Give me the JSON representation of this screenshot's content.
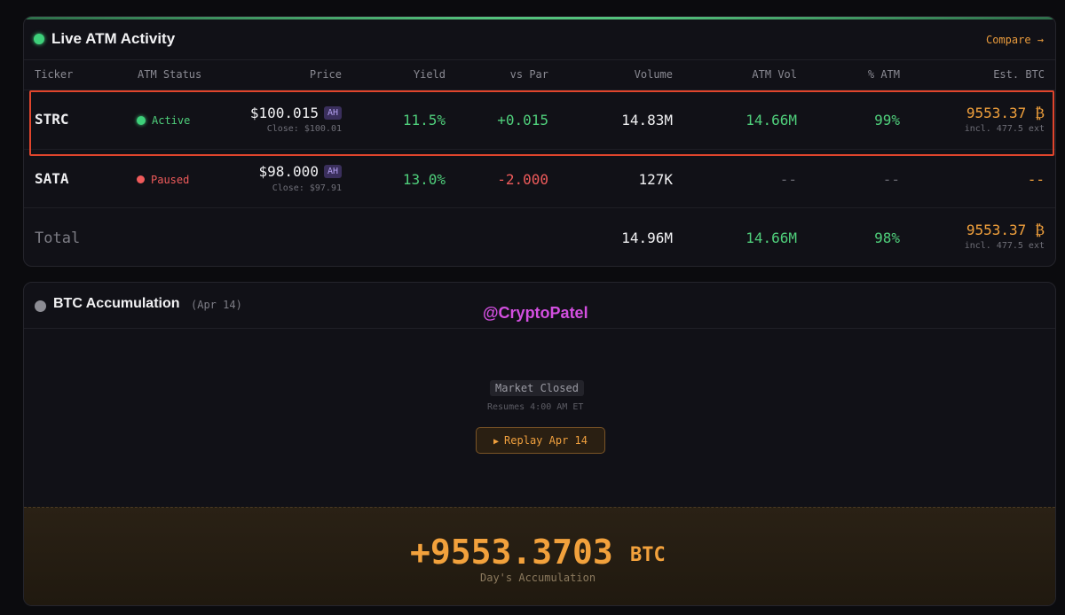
{
  "atm": {
    "title": "Live ATM Activity",
    "compare_label": "Compare →",
    "columns": [
      "Ticker",
      "ATM Status",
      "Price",
      "Yield",
      "vs Par",
      "Volume",
      "ATM Vol",
      "% ATM",
      "Est. BTC"
    ],
    "rows": [
      {
        "ticker": "STRC",
        "status": "Active",
        "price": "$100.015",
        "badge": "AH",
        "close": "Close: $100.01",
        "yield": "11.5%",
        "vs_par": "+0.015",
        "volume": "14.83M",
        "atm_vol": "14.66M",
        "pct_atm": "99%",
        "est_btc": "9553.37 ₿",
        "est_btc_sub": "incl. 477.5 ext"
      },
      {
        "ticker": "SATA",
        "status": "Paused",
        "price": "$98.000",
        "badge": "AH",
        "close": "Close: $97.91",
        "yield": "13.0%",
        "vs_par": "-2.000",
        "volume": "127K",
        "atm_vol": "--",
        "pct_atm": "--",
        "est_btc": "--"
      }
    ],
    "total": {
      "label": "Total",
      "volume": "14.96M",
      "atm_vol": "14.66M",
      "pct_atm": "98%",
      "est_btc": "9553.37 ₿",
      "est_btc_sub": "incl. 477.5 ext"
    },
    "colors": {
      "active": "#3ed07a",
      "paused": "#ef5b5b",
      "highlight": "#e0452c"
    }
  },
  "accumulation": {
    "title": "BTC Accumulation",
    "date": "(Apr 14)",
    "watermark": "@CryptoPatel",
    "market_status": "Market Closed",
    "resumes": "Resumes 4:00 AM ET",
    "replay_label": "Replay Apr 14",
    "value": "+9553.3703",
    "unit": "BTC",
    "value_label": "Day's Accumulation"
  }
}
